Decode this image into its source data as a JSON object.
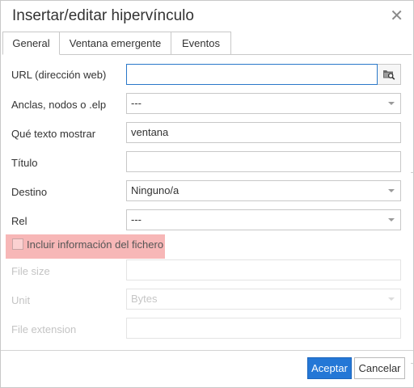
{
  "dialog": {
    "title": "Insertar/editar hipervínculo",
    "close_icon": "close-icon"
  },
  "tabs": [
    {
      "label": "General",
      "active": true
    },
    {
      "label": "Ventana emergente",
      "active": false
    },
    {
      "label": "Eventos",
      "active": false
    }
  ],
  "form": {
    "url": {
      "label": "URL (dirección web)",
      "value": "",
      "browse_icon": "folder-search-icon"
    },
    "anchors": {
      "label": "Anclas, nodos o .elp",
      "value": "---"
    },
    "text_to_display": {
      "label": "Qué texto mostrar",
      "value": "ventana"
    },
    "title": {
      "label": "Título",
      "value": ""
    },
    "target": {
      "label": "Destino",
      "value": "Ninguno/a"
    },
    "rel": {
      "label": "Rel",
      "value": "---"
    },
    "include_file_info": {
      "label": "Incluir información del fichero",
      "checked": false
    },
    "file_size": {
      "label": "File size",
      "value": ""
    },
    "unit": {
      "label": "Unit",
      "value": "Bytes"
    },
    "file_extension": {
      "label": "File extension",
      "value": ""
    }
  },
  "buttons": {
    "ok": "Aceptar",
    "cancel": "Cancelar"
  },
  "colors": {
    "primary": "#2477d6",
    "highlight": "#f7b7b7",
    "focus_border": "#2a78c9"
  }
}
